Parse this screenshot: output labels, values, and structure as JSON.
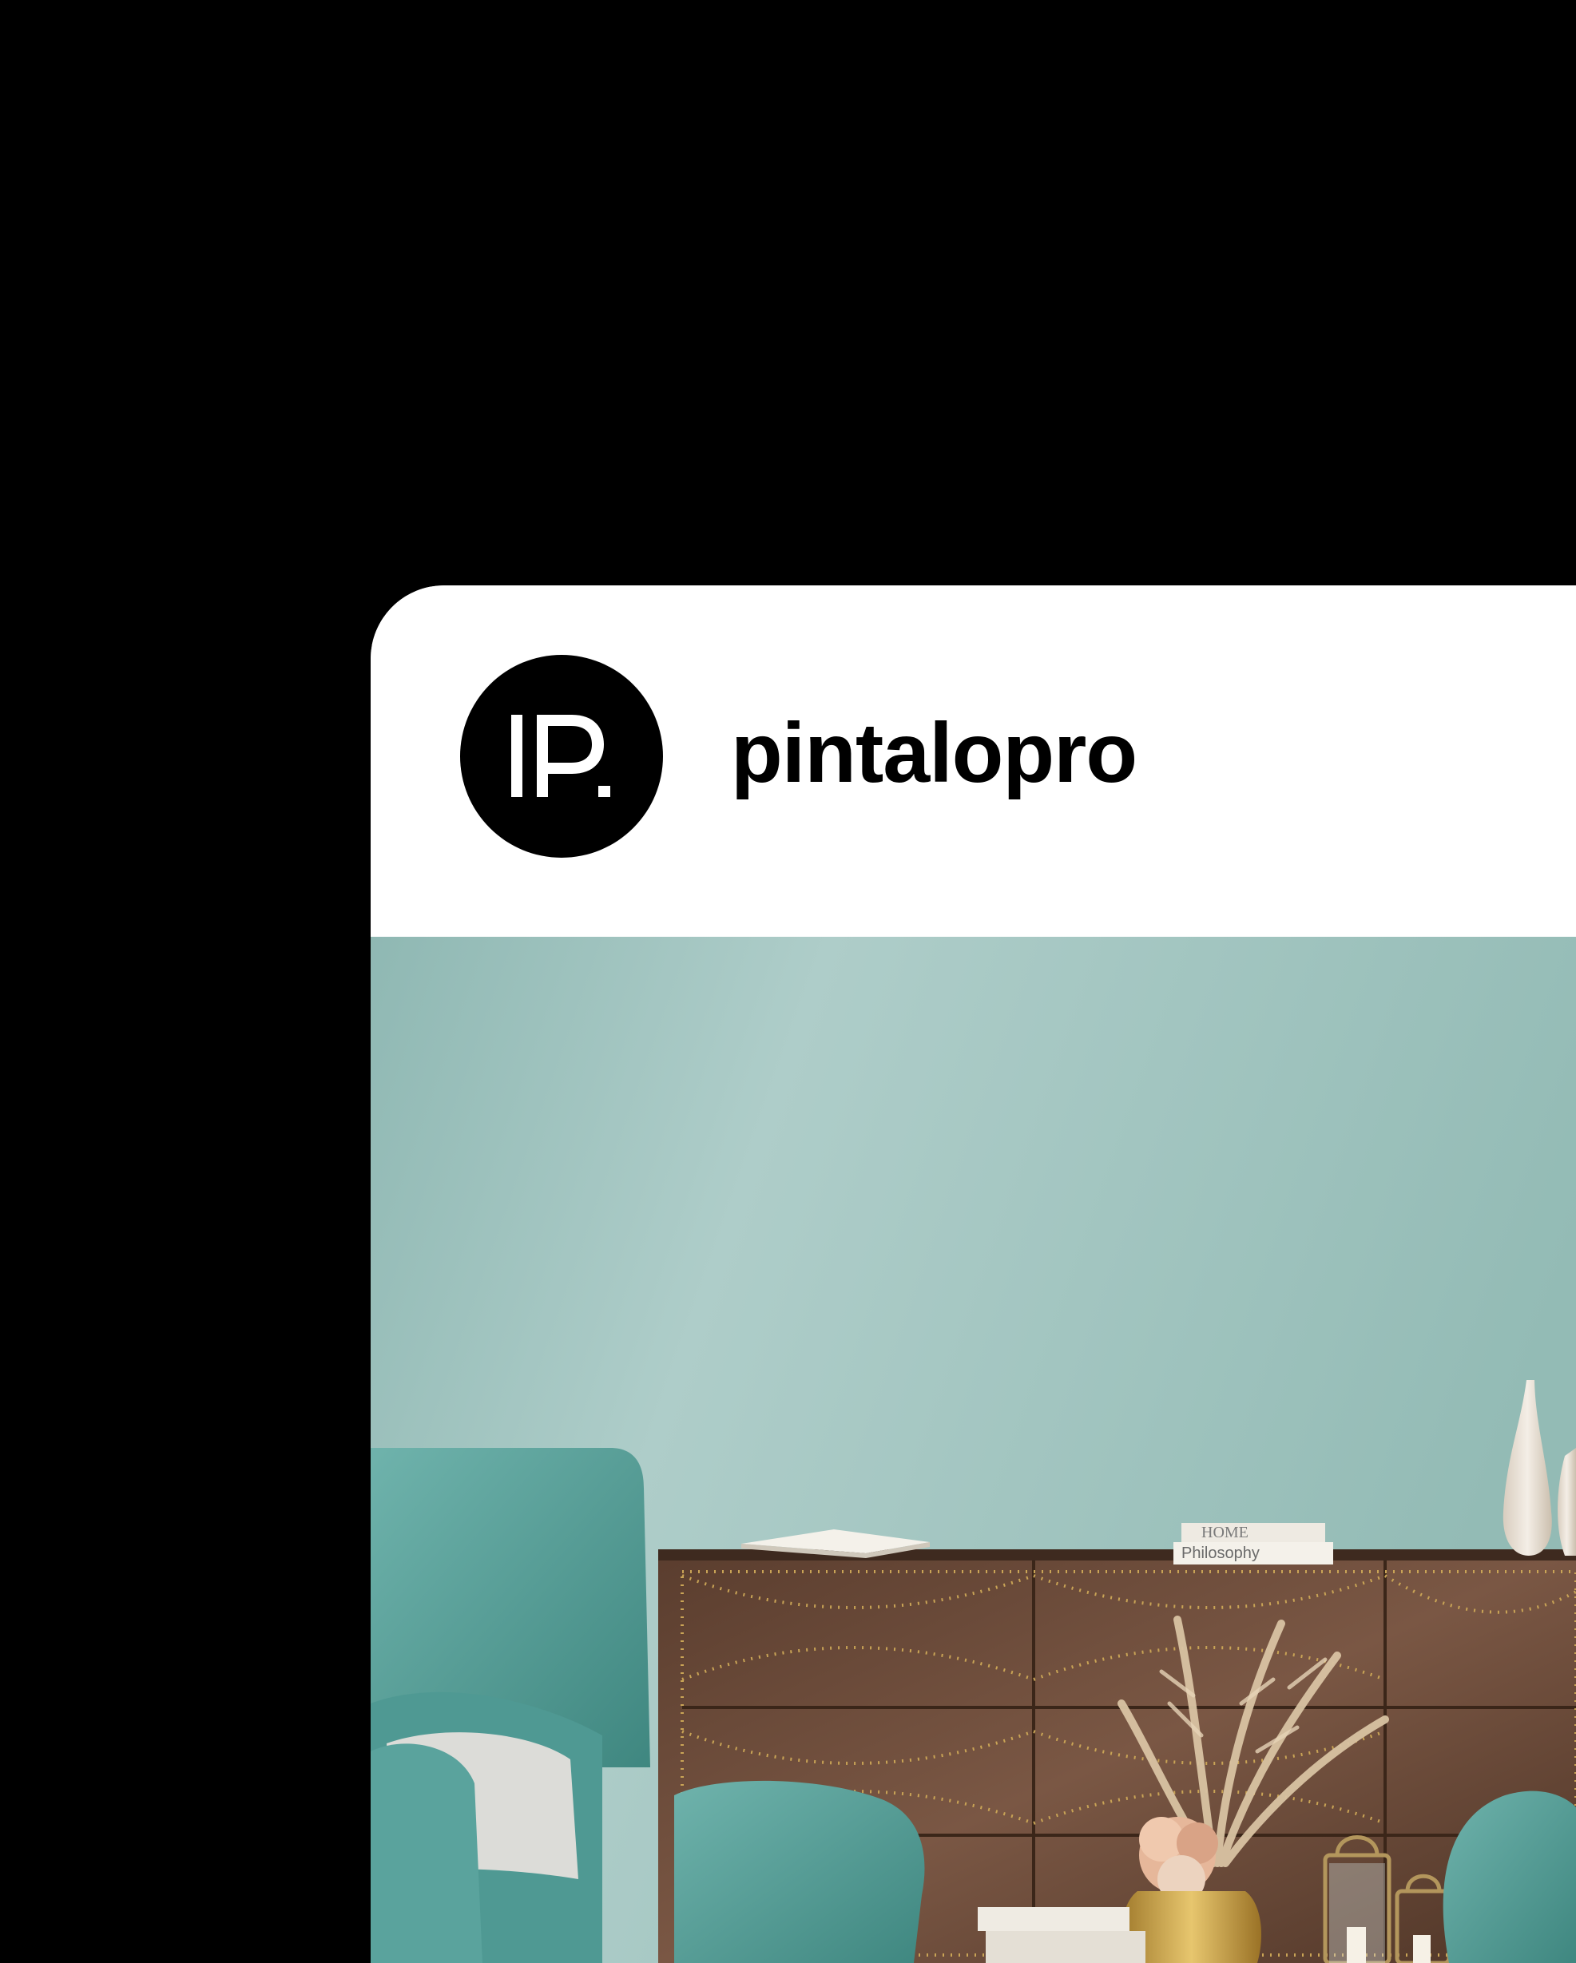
{
  "profile": {
    "username": "pintalopro",
    "avatar_icon": "pintalopro-logo-icon"
  },
  "post": {
    "book_spine_top": "HOME",
    "book_spine_bottom": "Philosophy"
  },
  "colors": {
    "background": "#000000",
    "card": "#ffffff",
    "wall": "#9fc2bd",
    "armchair": "#5fa6a0",
    "dresser": "#6a4a38"
  }
}
